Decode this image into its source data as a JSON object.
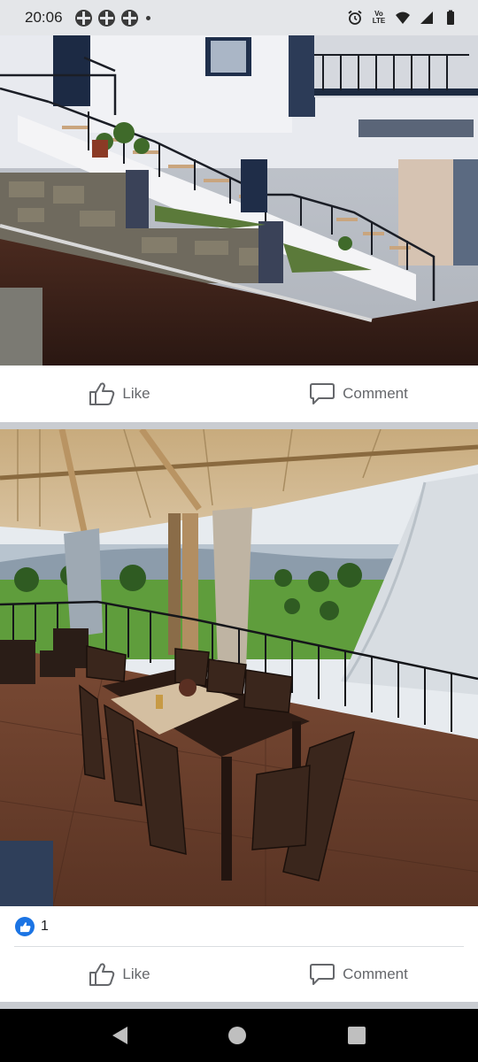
{
  "status_bar": {
    "time": "20:06",
    "network_badge": "Vo LTE"
  },
  "post1": {
    "photo_icon": "landscape-photo",
    "like_label": "Like",
    "comment_label": "Comment"
  },
  "post2": {
    "photo_icon": "landscape-photo",
    "reaction_count": "1",
    "like_label": "Like",
    "comment_label": "Comment"
  },
  "colors": {
    "facebook_blue": "#1b74e4",
    "action_text": "#65676b"
  }
}
